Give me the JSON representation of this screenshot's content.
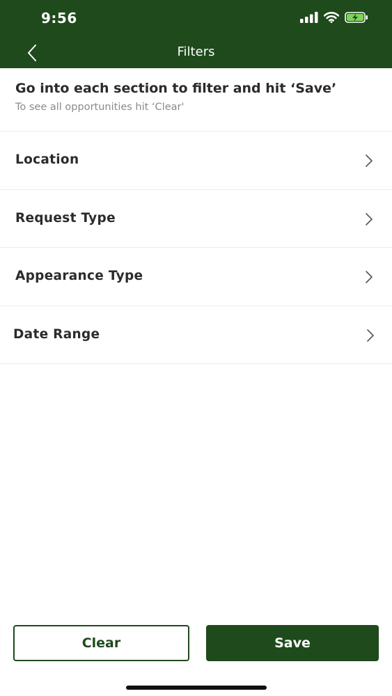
{
  "status_bar": {
    "time": "9:56"
  },
  "nav": {
    "title": "Filters"
  },
  "intro": {
    "title": "Go into each section to filter and hit ‘Save’",
    "subtitle": "To see all opportunities hit ‘Clear'"
  },
  "filters": [
    {
      "label": "Location"
    },
    {
      "label": "Request Type"
    },
    {
      "label": "Appearance Type"
    },
    {
      "label": "Date Range"
    }
  ],
  "buttons": {
    "clear": "Clear",
    "save": "Save"
  },
  "colors": {
    "brand": "#1f4a1c",
    "text": "#2b2b2b",
    "muted": "#8a8a8a",
    "divider": "#ececec"
  },
  "icons": [
    "back-chevron-icon",
    "cellular-signal-icon",
    "wifi-icon",
    "battery-charging-icon",
    "chevron-right-icon"
  ]
}
